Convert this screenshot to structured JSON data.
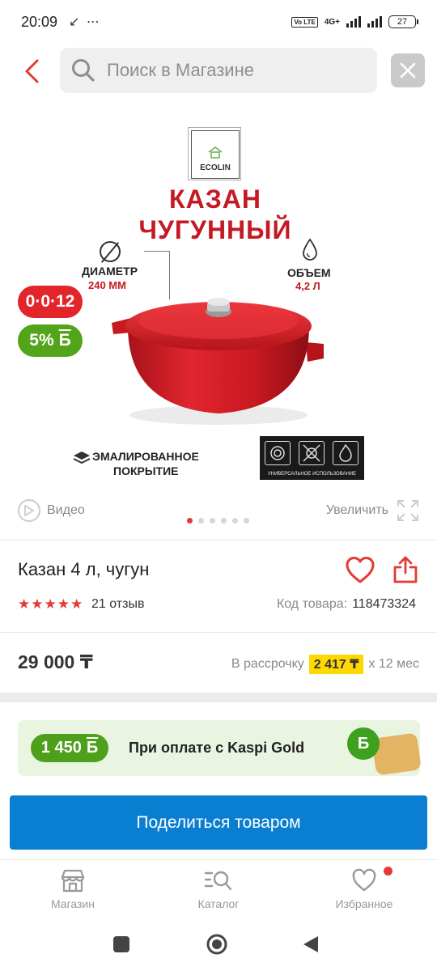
{
  "status_bar": {
    "time": "20:09",
    "extra_icons": "↙ ⋯",
    "lte_label": "Vo LTE",
    "network_label": "4G+",
    "battery": "27"
  },
  "header": {
    "search_placeholder": "Поиск в Магазине",
    "back_icon": "chevron-left-icon",
    "close_icon": "close-icon"
  },
  "product_image": {
    "brand": "ECOLIN",
    "title_line1": "КАЗАН",
    "title_line2": "ЧУГУННЫЙ",
    "diameter_label": "ДИАМЕТР",
    "diameter_value": "240 ММ",
    "volume_label": "ОБЪЕМ",
    "volume_value": "4,2 Л",
    "coating_line1": "ЭМАЛИРОВАННОЕ",
    "coating_line2": "ПОКРЫТИЕ",
    "usage_text": "УНИВЕРСАЛЬНОЕ ИСПОЛЬЗОВАНИЕ",
    "installment_badge": "0·0·12",
    "bonus_badge": "5%",
    "bonus_currency": "Б",
    "accent_red": "#c41a23"
  },
  "media_controls": {
    "video_label": "Видео",
    "zoom_label": "Увеличить",
    "slides_total": 6,
    "slide_active": 1
  },
  "product": {
    "name": "Казан 4 л, чугун",
    "rating": 5,
    "reviews": "21 отзыв",
    "sku_label": "Код товара:",
    "sku_value": "118473324",
    "price": "29 000 ₸",
    "installment_label": "В рассрочку",
    "installment_amount": "2 417 ₸",
    "installment_term": "х 12 мес"
  },
  "kaspi_gold": {
    "bonus": "1 450",
    "bonus_currency": "Б",
    "text": "При оплате с Kaspi Gold"
  },
  "share_button": "Поделиться товаром",
  "tabbar": {
    "items": [
      {
        "label": "Магазин",
        "icon": "store-icon"
      },
      {
        "label": "Каталог",
        "icon": "catalog-search-icon"
      },
      {
        "label": "Избранное",
        "icon": "heart-icon"
      }
    ]
  },
  "colors": {
    "primary_blue": "#0a7fd1",
    "kaspi_red": "#e53935",
    "bonus_green": "#52a51a",
    "highlight_yellow": "#ffd800"
  }
}
